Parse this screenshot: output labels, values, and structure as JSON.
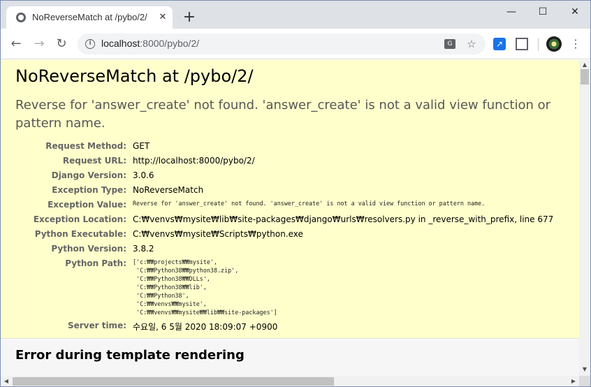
{
  "browser": {
    "tab_title": "NoReverseMatch at /pybo/2/",
    "tab_close": "✕",
    "new_tab": "+",
    "window_controls": {
      "minimize": "—",
      "maximize": "☐",
      "close": "✕"
    },
    "url_host": "localhost",
    "url_path": ":8000/pybo/2/",
    "icons": {
      "back": "back-arrow-icon",
      "forward": "forward-arrow-icon",
      "reload": "reload-icon",
      "info": "info-icon",
      "translate": "translate-icon",
      "bookmark": "star-icon",
      "extension_1": "expand-arrow-icon",
      "extension_2": "screenshot-frame-icon",
      "profile": "avatar",
      "menu": "kebab-menu-icon"
    }
  },
  "error": {
    "title": "NoReverseMatch at /pybo/2/",
    "message": "Reverse for 'answer_create' not found. 'answer_create' is not a valid view function or pattern name.",
    "summary_bg": "#ffffcc"
  },
  "meta": [
    {
      "key": "Request Method:",
      "value": "GET"
    },
    {
      "key": "Request URL:",
      "value": "http://localhost:8000/pybo/2/"
    },
    {
      "key": "Django Version:",
      "value": "3.0.6"
    },
    {
      "key": "Exception Type:",
      "value": "NoReverseMatch"
    },
    {
      "key": "Exception Value:",
      "value": "Reverse for 'answer_create' not found. 'answer_create' is not a valid view function or pattern name."
    },
    {
      "key": "Exception Location:",
      "value": "C:₩venvs₩mysite₩lib₩site-packages₩django₩urls₩resolvers.py in _reverse_with_prefix, line 677"
    },
    {
      "key": "Python Executable:",
      "value": "C:₩venvs₩mysite₩Scripts₩python.exe"
    },
    {
      "key": "Python Version:",
      "value": "3.8.2"
    },
    {
      "key": "Python Path:",
      "value": "['c:₩₩projects₩₩mysite',\n 'C:₩₩Python38₩₩python38.zip',\n 'C:₩₩Python38₩₩DLLs',\n 'C:₩₩Python38₩₩lib',\n 'C:₩₩Python38',\n 'C:₩₩venvs₩₩mysite',\n 'C:₩₩venvs₩₩mysite₩₩lib₩₩site-packages']"
    },
    {
      "key": "Server time:",
      "value": "수요일, 6 5월 2020 18:09:07 +0900"
    }
  ],
  "template_section": {
    "title": "Error during template rendering"
  }
}
